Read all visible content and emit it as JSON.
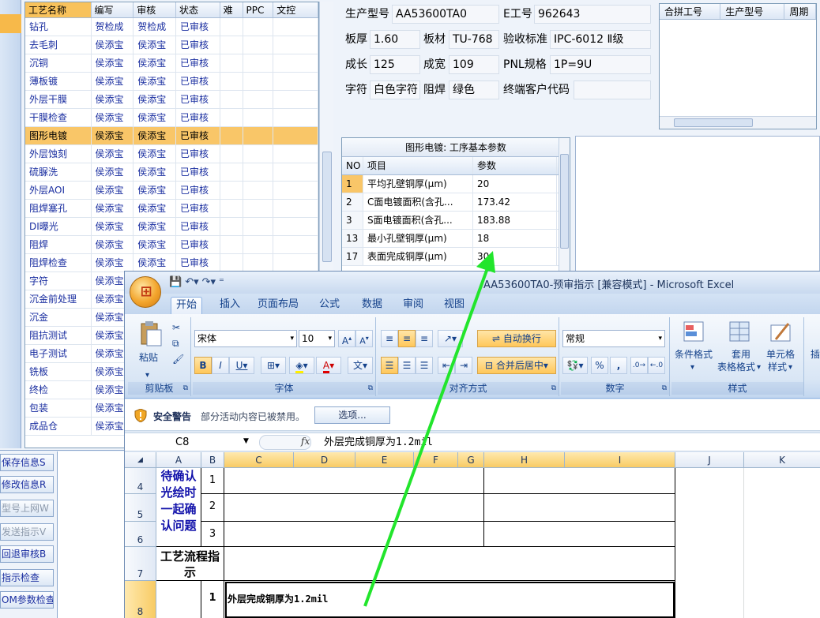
{
  "process_grid": {
    "headers": [
      "工艺名称",
      "编写",
      "审核",
      "状态",
      "难",
      "PPC",
      "文控"
    ],
    "rows": [
      [
        "钻孔",
        "贺检成",
        "贺检成",
        "已审核"
      ],
      [
        "去毛刺",
        "侯添宝",
        "侯添宝",
        "已审核"
      ],
      [
        "沉铜",
        "侯添宝",
        "侯添宝",
        "已审核"
      ],
      [
        "薄板镀",
        "侯添宝",
        "侯添宝",
        "已审核"
      ],
      [
        "外层干膜",
        "侯添宝",
        "侯添宝",
        "已审核"
      ],
      [
        "干膜检查",
        "侯添宝",
        "侯添宝",
        "已审核"
      ],
      [
        "图形电镀",
        "侯添宝",
        "侯添宝",
        "已审核"
      ],
      [
        "外层蚀刻",
        "侯添宝",
        "侯添宝",
        "已审核"
      ],
      [
        "硫脲洗",
        "侯添宝",
        "侯添宝",
        "已审核"
      ],
      [
        "外层AOI",
        "侯添宝",
        "侯添宝",
        "已审核"
      ],
      [
        "阻焊塞孔",
        "侯添宝",
        "侯添宝",
        "已审核"
      ],
      [
        "DI曝光",
        "侯添宝",
        "侯添宝",
        "已审核"
      ],
      [
        "阻焊",
        "侯添宝",
        "侯添宝",
        "已审核"
      ],
      [
        "阻焊检查",
        "侯添宝",
        "侯添宝",
        "已审核"
      ],
      [
        "字符",
        "侯添宝",
        "",
        ""
      ],
      [
        "沉金前处理",
        "侯添宝",
        "",
        ""
      ],
      [
        "沉金",
        "侯添宝",
        "",
        ""
      ],
      [
        "阻抗测试",
        "侯添宝",
        "",
        ""
      ],
      [
        "电子测试",
        "侯添宝",
        "",
        ""
      ],
      [
        "铣板",
        "侯添宝",
        "",
        ""
      ],
      [
        "终检",
        "侯添宝",
        "",
        ""
      ],
      [
        "包装",
        "侯添宝",
        "",
        ""
      ],
      [
        "成品仓",
        "侯添宝",
        "",
        ""
      ]
    ],
    "selected_index": 6
  },
  "left_buttons": [
    {
      "label": "保存信息S",
      "enabled": true
    },
    {
      "label": "修改信息R",
      "enabled": true
    },
    {
      "label": "型号上网W",
      "enabled": false
    },
    {
      "label": "发送指示V",
      "enabled": false
    },
    {
      "label": "回退审核B",
      "enabled": true
    },
    {
      "label": "指示检查",
      "enabled": true
    },
    {
      "label": "OM参数检查",
      "enabled": true
    }
  ],
  "product_info": {
    "model_label": "生产型号",
    "model_value": "AA53600TA0",
    "e_label": "E工号",
    "e_value": "962643",
    "thickness_label": "板厚",
    "thickness_value": "1.60",
    "material_label": "板材",
    "material_value": "TU-768",
    "standard_label": "验收标准",
    "standard_value": "IPC-6012 Ⅱ级",
    "length_label": "成长",
    "length_value": "125",
    "width_label": "成宽",
    "width_value": "109",
    "pnl_label": "PNL规格",
    "pnl_value": "1P=9U",
    "char_label": "字符",
    "char_value": "白色字符",
    "mask_label": "阻焊",
    "mask_value": "绿色",
    "customer_label": "终端客户代码",
    "customer_value": ""
  },
  "combined_list": {
    "headers": [
      "合拼工号",
      "生产型号",
      "周期"
    ]
  },
  "param_grid": {
    "title": "图形电镀: 工序基本参数",
    "headers": [
      "NO",
      "项目",
      "参数"
    ],
    "rows": [
      [
        "1",
        "平均孔壁铜厚(μm)",
        "20"
      ],
      [
        "2",
        "C面电镀面积(含孔...",
        "173.42"
      ],
      [
        "3",
        "S面电镀面积(含孔...",
        "183.88"
      ],
      [
        "13",
        "最小孔壁铜厚(μm)",
        "18"
      ],
      [
        "17",
        "表面完成铜厚(μm)",
        "30"
      ]
    ]
  },
  "excel": {
    "title": "AA53600TA0-预审指示 [兼容模式] - Microsoft Excel",
    "tabs": [
      "开始",
      "插入",
      "页面布局",
      "公式",
      "数据",
      "审阅",
      "视图"
    ],
    "active_tab": 0,
    "ribbon": {
      "paste": "粘贴",
      "clipboard": "剪贴板",
      "font_name": "宋体",
      "font_size": "10",
      "font_group": "字体",
      "wrap": "自动换行",
      "merge": "合并后居中",
      "align_group": "对齐方式",
      "number_format": "常规",
      "number_group": "数字",
      "percent": "%",
      "comma": ",",
      "cond_format": "条件格式",
      "table_style_1": "套用",
      "table_style_2": "表格格式",
      "cell_style_1": "单元格",
      "cell_style_2": "样式",
      "style_group": "样式",
      "insert_partial": "插"
    },
    "security": {
      "title": "安全警告",
      "message": "部分活动内容已被禁用。",
      "options": "选项..."
    },
    "name_box": "C8",
    "formula": "外层完成铜厚为1.2mil",
    "columns": [
      "A",
      "B",
      "C",
      "D",
      "E",
      "F",
      "G",
      "H",
      "I",
      "J",
      "K"
    ],
    "rows": [
      {
        "num": "4",
        "b": "1"
      },
      {
        "num": "5",
        "b": "2"
      },
      {
        "num": "6",
        "b": "3"
      },
      {
        "num": "7",
        "b": ""
      },
      {
        "num": "8",
        "b": "1"
      }
    ],
    "merged_a_4_6": "待确认光绘时一起确认问题",
    "merged_a_7": "工艺流程指示",
    "cell_c8": "外层完成铜厚为1.2mil"
  },
  "colors": {
    "selected_row": "#f9c668",
    "arrow": "#22e52c",
    "excel_blue": "#15428b"
  }
}
